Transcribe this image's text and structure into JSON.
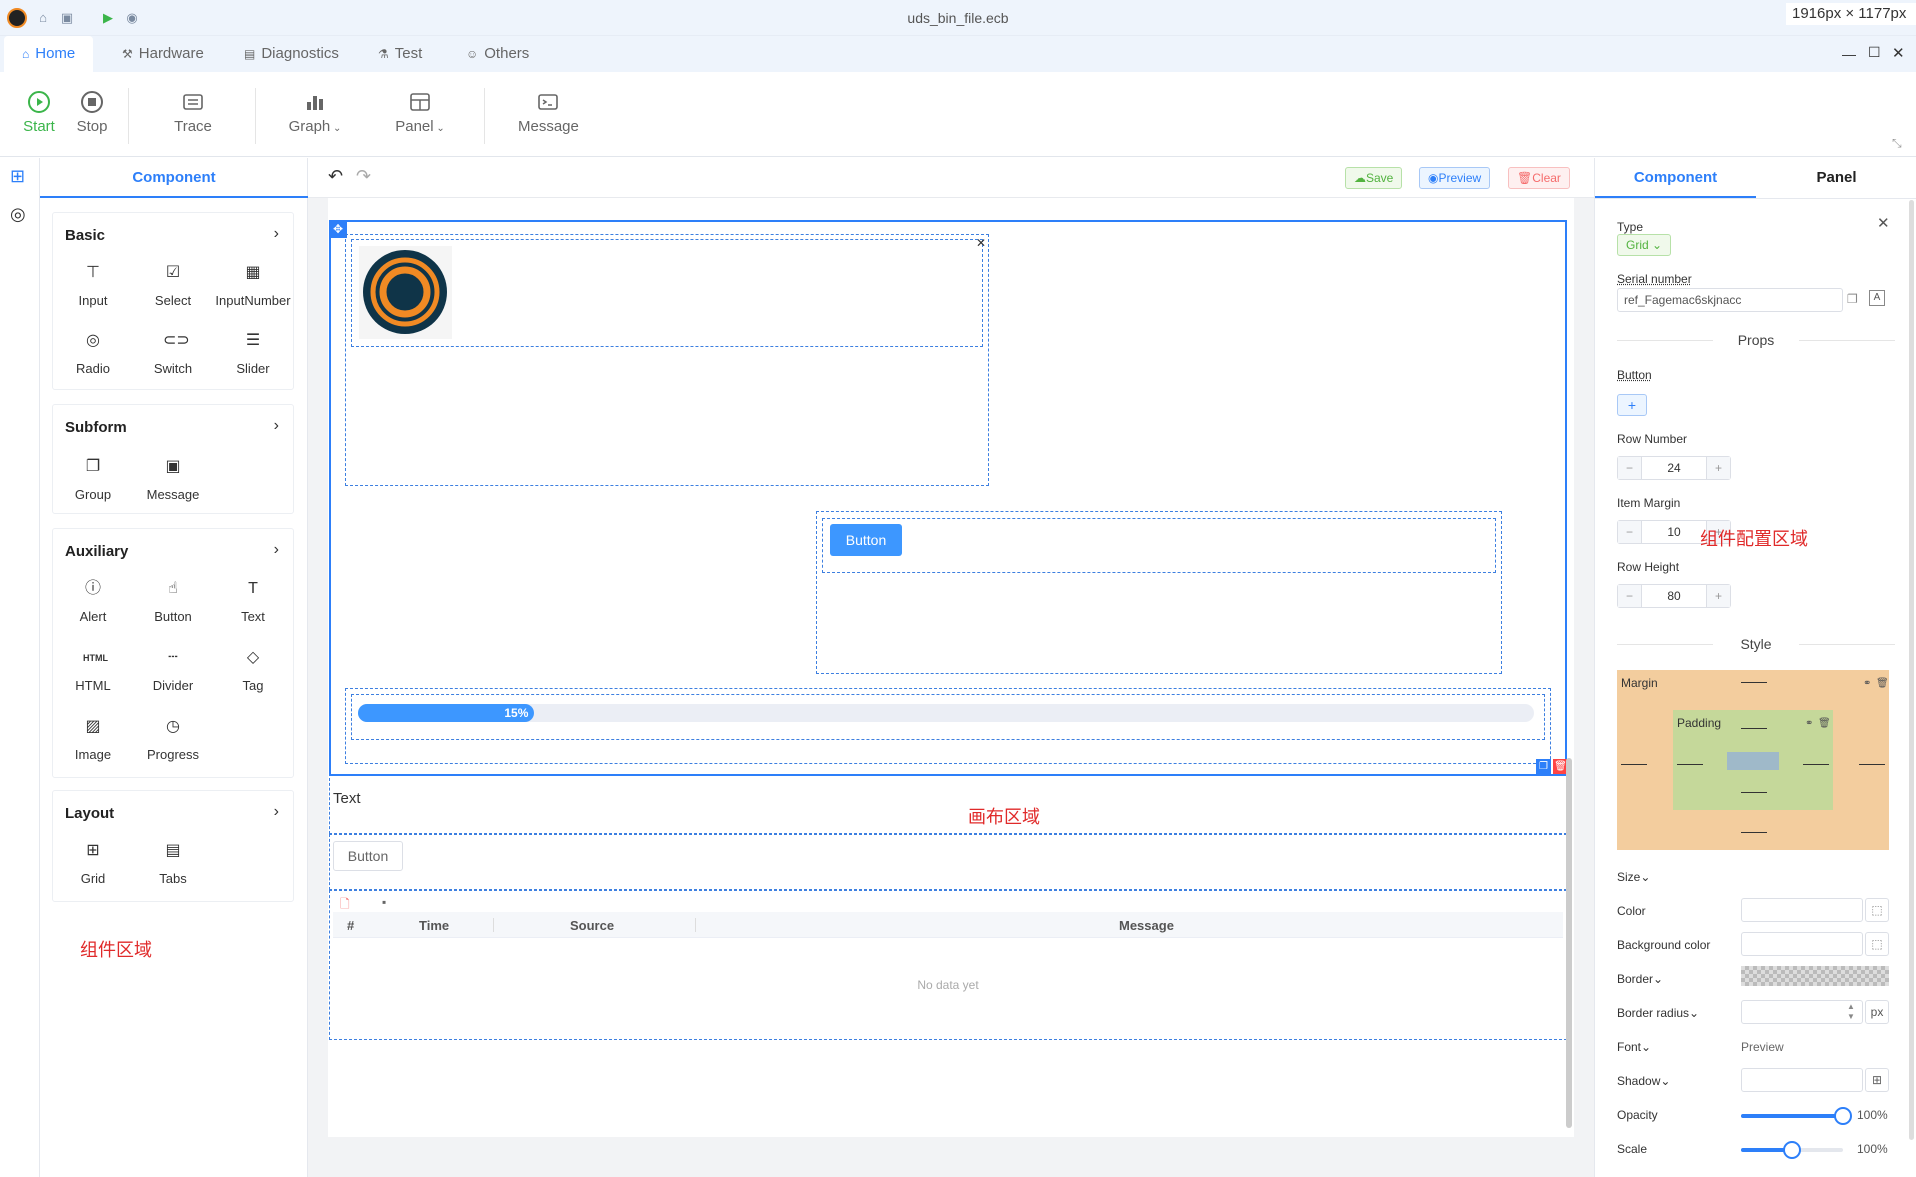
{
  "window": {
    "title": "uds_bin_file.ecb",
    "dimension_label": "1916px × 1177px"
  },
  "nav_tabs": [
    {
      "label": "Home",
      "icon": "home-icon"
    },
    {
      "label": "Hardware",
      "icon": "hammer-icon"
    },
    {
      "label": "Diagnostics",
      "icon": "document-icon"
    },
    {
      "label": "Test",
      "icon": "flask-icon"
    },
    {
      "label": "Others",
      "icon": "user-icon"
    }
  ],
  "ribbon": {
    "start": "Start",
    "stop": "Stop",
    "trace": "Trace",
    "graph": "Graph",
    "panel": "Panel",
    "message": "Message"
  },
  "left_panel": {
    "tab": "Component",
    "groups": {
      "basic": {
        "title": "Basic",
        "items": [
          "Input",
          "Select",
          "InputNumber",
          "Radio",
          "Switch",
          "Slider"
        ]
      },
      "subform": {
        "title": "Subform",
        "items": [
          "Group",
          "Message"
        ]
      },
      "auxiliary": {
        "title": "Auxiliary",
        "items": [
          "Alert",
          "Button",
          "Text",
          "HTML",
          "Divider",
          "Tag",
          "Image",
          "Progress"
        ]
      },
      "layout": {
        "title": "Layout",
        "items": [
          "Grid",
          "Tabs"
        ]
      }
    },
    "annotation": "组件区域"
  },
  "canvas": {
    "save": "Save",
    "preview": "Preview",
    "clear": "Clear",
    "button_label": "Button",
    "progress": 0.15,
    "progress_label": "15%",
    "text_label": "Text",
    "annotation": "画布区域",
    "plain_button": "Button",
    "table": {
      "columns": [
        "#",
        "Time",
        "Source",
        "Message"
      ],
      "empty": "No data yet"
    }
  },
  "right_panel": {
    "tabs": [
      "Component",
      "Panel"
    ],
    "type_label": "Type",
    "type_value": "Grid",
    "serial_label": "Serial number",
    "serial_value": "ref_Fagemac6skjnacc",
    "props_title": "Props",
    "button_label": "Button",
    "row_number_label": "Row Number",
    "row_number": "24",
    "item_margin_label": "Item Margin",
    "item_margin": "10",
    "row_height_label": "Row Height",
    "row_height": "80",
    "annotation": "组件配置区域",
    "style_title": "Style",
    "margin_label": "Margin",
    "padding_label": "Padding",
    "size_label": "Size",
    "color_label": "Color",
    "bg_color_label": "Background color",
    "border_label": "Border",
    "border_radius_label": "Border radius",
    "px_unit": "px",
    "font_label": "Font",
    "font_value": "Preview",
    "shadow_label": "Shadow",
    "opacity_label": "Opacity",
    "opacity_value": "100%",
    "opacity": 1.0,
    "scale_label": "Scale",
    "scale_value": "100%",
    "scale": 0.5,
    "colors": {
      "accent": "#2d7ff9",
      "margin_box": "#f3cd9e",
      "padding_box": "#c5d89a"
    }
  }
}
